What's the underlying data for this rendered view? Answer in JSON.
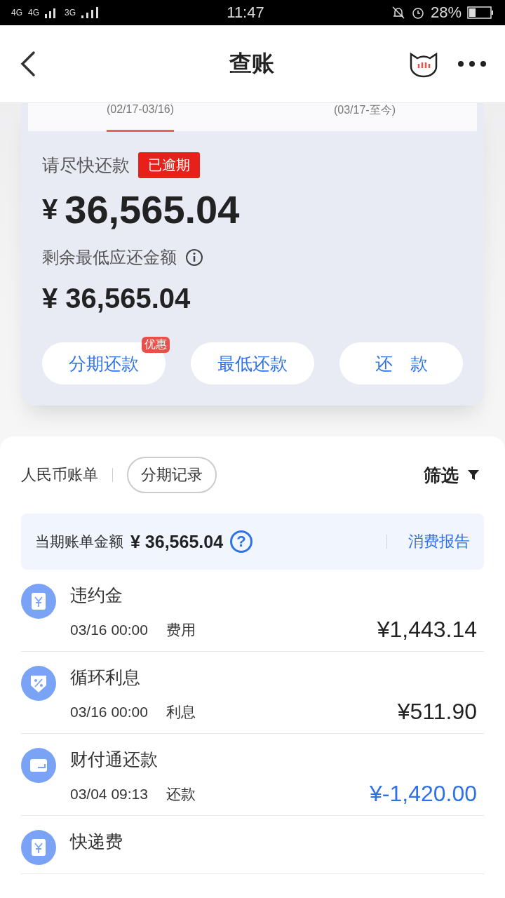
{
  "status_bar": {
    "network_1": "4G",
    "network_2": "4G",
    "network_3": "3G",
    "time": "11:47",
    "battery": "28%"
  },
  "header": {
    "title": "查账"
  },
  "period_tabs": [
    {
      "label": "(02/17-03/16)",
      "selected": true
    },
    {
      "label": "(03/17-至今)",
      "selected": false
    }
  ],
  "summary": {
    "prompt": "请尽快还款",
    "badge": "已逾期",
    "amount": "36,565.04",
    "currency": "¥",
    "min_label": "剩余最低应还金额",
    "min_amount": "¥ 36,565.04"
  },
  "actions": [
    {
      "label": "分期还款",
      "tag": "优惠"
    },
    {
      "label": "最低还款"
    },
    {
      "label": "还　款"
    }
  ],
  "bill": {
    "title": "人民币账单",
    "installments_button": "分期记录",
    "filter": "筛选",
    "total_label": "当期账单金额",
    "total_amount": "¥ 36,565.04",
    "help": "?",
    "report_link": "消费报告"
  },
  "transactions": [
    {
      "kind": "yuan",
      "title": "违约金",
      "time": "03/16 00:00",
      "type": "费用",
      "amount": "¥1,443.14",
      "credit": false
    },
    {
      "kind": "percent",
      "title": "循环利息",
      "time": "03/16 00:00",
      "type": "利息",
      "amount": "¥511.90",
      "credit": false
    },
    {
      "kind": "wallet",
      "title": "财付通还款",
      "time": "03/04 09:13",
      "type": "还款",
      "amount": "¥-1,420.00",
      "credit": true
    },
    {
      "kind": "yuan",
      "title": "快递费"
    }
  ]
}
